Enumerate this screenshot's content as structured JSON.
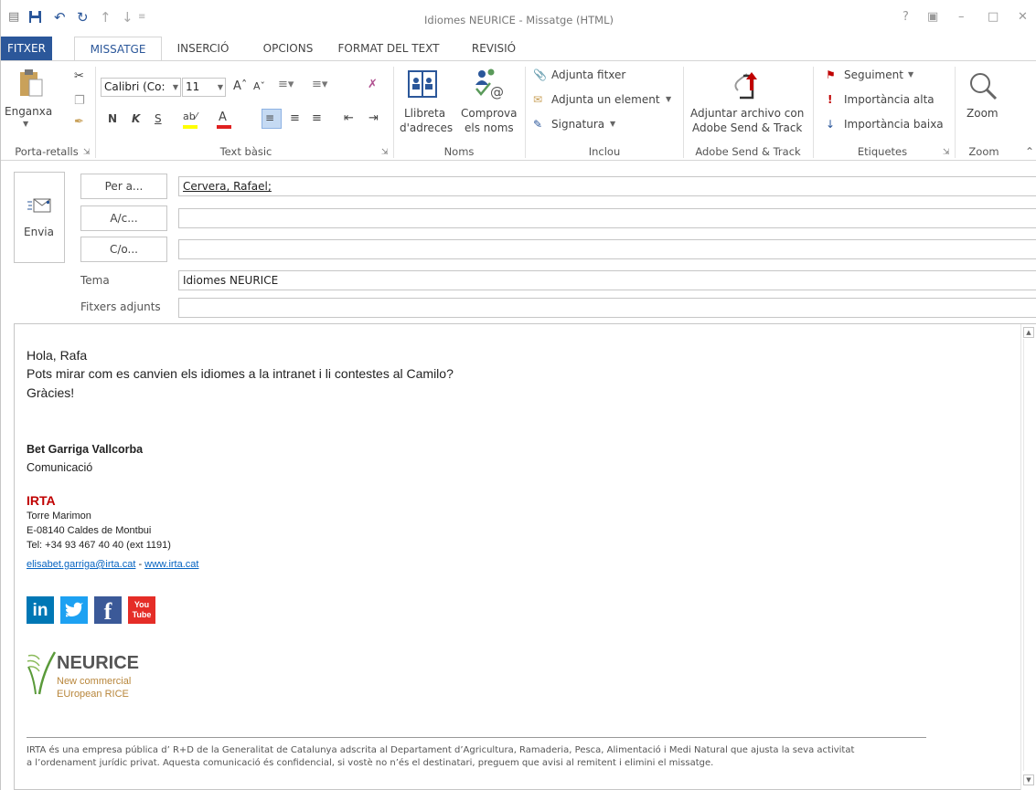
{
  "window": {
    "title": "Idiomes NEURICE - Missatge (HTML)",
    "controls": [
      "?",
      "▣",
      "–",
      "□",
      "✕"
    ]
  },
  "tabs": [
    "FITXER",
    "MISSATGE",
    "INSERCIÓ",
    "OPCIONS",
    "FORMAT DEL TEXT",
    "REVISIÓ"
  ],
  "ribbon": {
    "clipboard": {
      "paste_label": "Enganxa",
      "group": "Porta-retalls"
    },
    "basic_text": {
      "font_name": "Calibri (Co:",
      "font_size": "11",
      "bold": "N",
      "italic": "K",
      "underline": "S",
      "group": "Text bàsic"
    },
    "names": {
      "address_book_1": "Llibreta",
      "address_book_2": "d'adreces",
      "check_names_1": "Comprova",
      "check_names_2": "els noms",
      "group": "Noms"
    },
    "include": {
      "attach_file": "Adjunta fitxer",
      "attach_item": "Adjunta un element",
      "signature": "Signatura",
      "group": "Inclou"
    },
    "adobe": {
      "line1": "Adjuntar archivo con",
      "line2": "Adobe Send & Track",
      "group": "Adobe Send & Track"
    },
    "tags": {
      "follow_up": "Seguiment",
      "high": "Importància alta",
      "low": "Importància baixa",
      "group": "Etiquetes"
    },
    "zoom": {
      "label": "Zoom",
      "group": "Zoom"
    }
  },
  "header": {
    "send": "Envia",
    "to_btn": "Per a...",
    "cc_btn": "A/c...",
    "bcc_btn": "C/o...",
    "subject_label": "Tema",
    "attachments_label": "Fitxers adjunts",
    "to_value": "Cervera, Rafael;",
    "cc_value": "",
    "bcc_value": "",
    "subject_value": "Idiomes NEURICE",
    "attachments_value": ""
  },
  "body": {
    "lines": [
      "Hola, Rafa",
      "Pots mirar com es canvien els idiomes a la intranet i li contestes al Camilo?",
      "Gràcies!"
    ],
    "signature": {
      "name": "Bet Garriga Vallcorba",
      "dept": "Comunicació",
      "org": "IRTA",
      "addr1": "Torre Marimon",
      "addr2": "E-08140 Caldes de Montbui",
      "tel": "Tel: +34 93 467 40 40  (ext 1191)",
      "email": "elisabet.garriga@irta.cat",
      "sep": " - ",
      "web": "www.irta.cat"
    },
    "social": [
      "in",
      "t",
      "f",
      "You Tube"
    ],
    "logo": {
      "name": "NEURICE",
      "sub1": "New commercial",
      "sub2": "EUropean RICE"
    },
    "disclaimer1": "IRTA és una empresa pública d’ R+D de la Generalitat de Catalunya adscrita al Departament d’Agricultura, Ramaderia, Pesca, Alimentació i Medi Natural que ajusta la seva activitat",
    "disclaimer2": "a l’ordenament jurídic privat. Aquesta comunicació és confidencial, si vostè no n’és el destinatari, preguem que avisi al remitent i elimini el missatge."
  },
  "colors": {
    "accent": "#2b579a",
    "irta_red": "#c00000",
    "link": "#0563c1",
    "linkedin": "#0077b5",
    "twitter": "#1da1f2",
    "facebook": "#3b5998",
    "youtube": "#e52d27",
    "neurice_gold": "#b8863b"
  }
}
